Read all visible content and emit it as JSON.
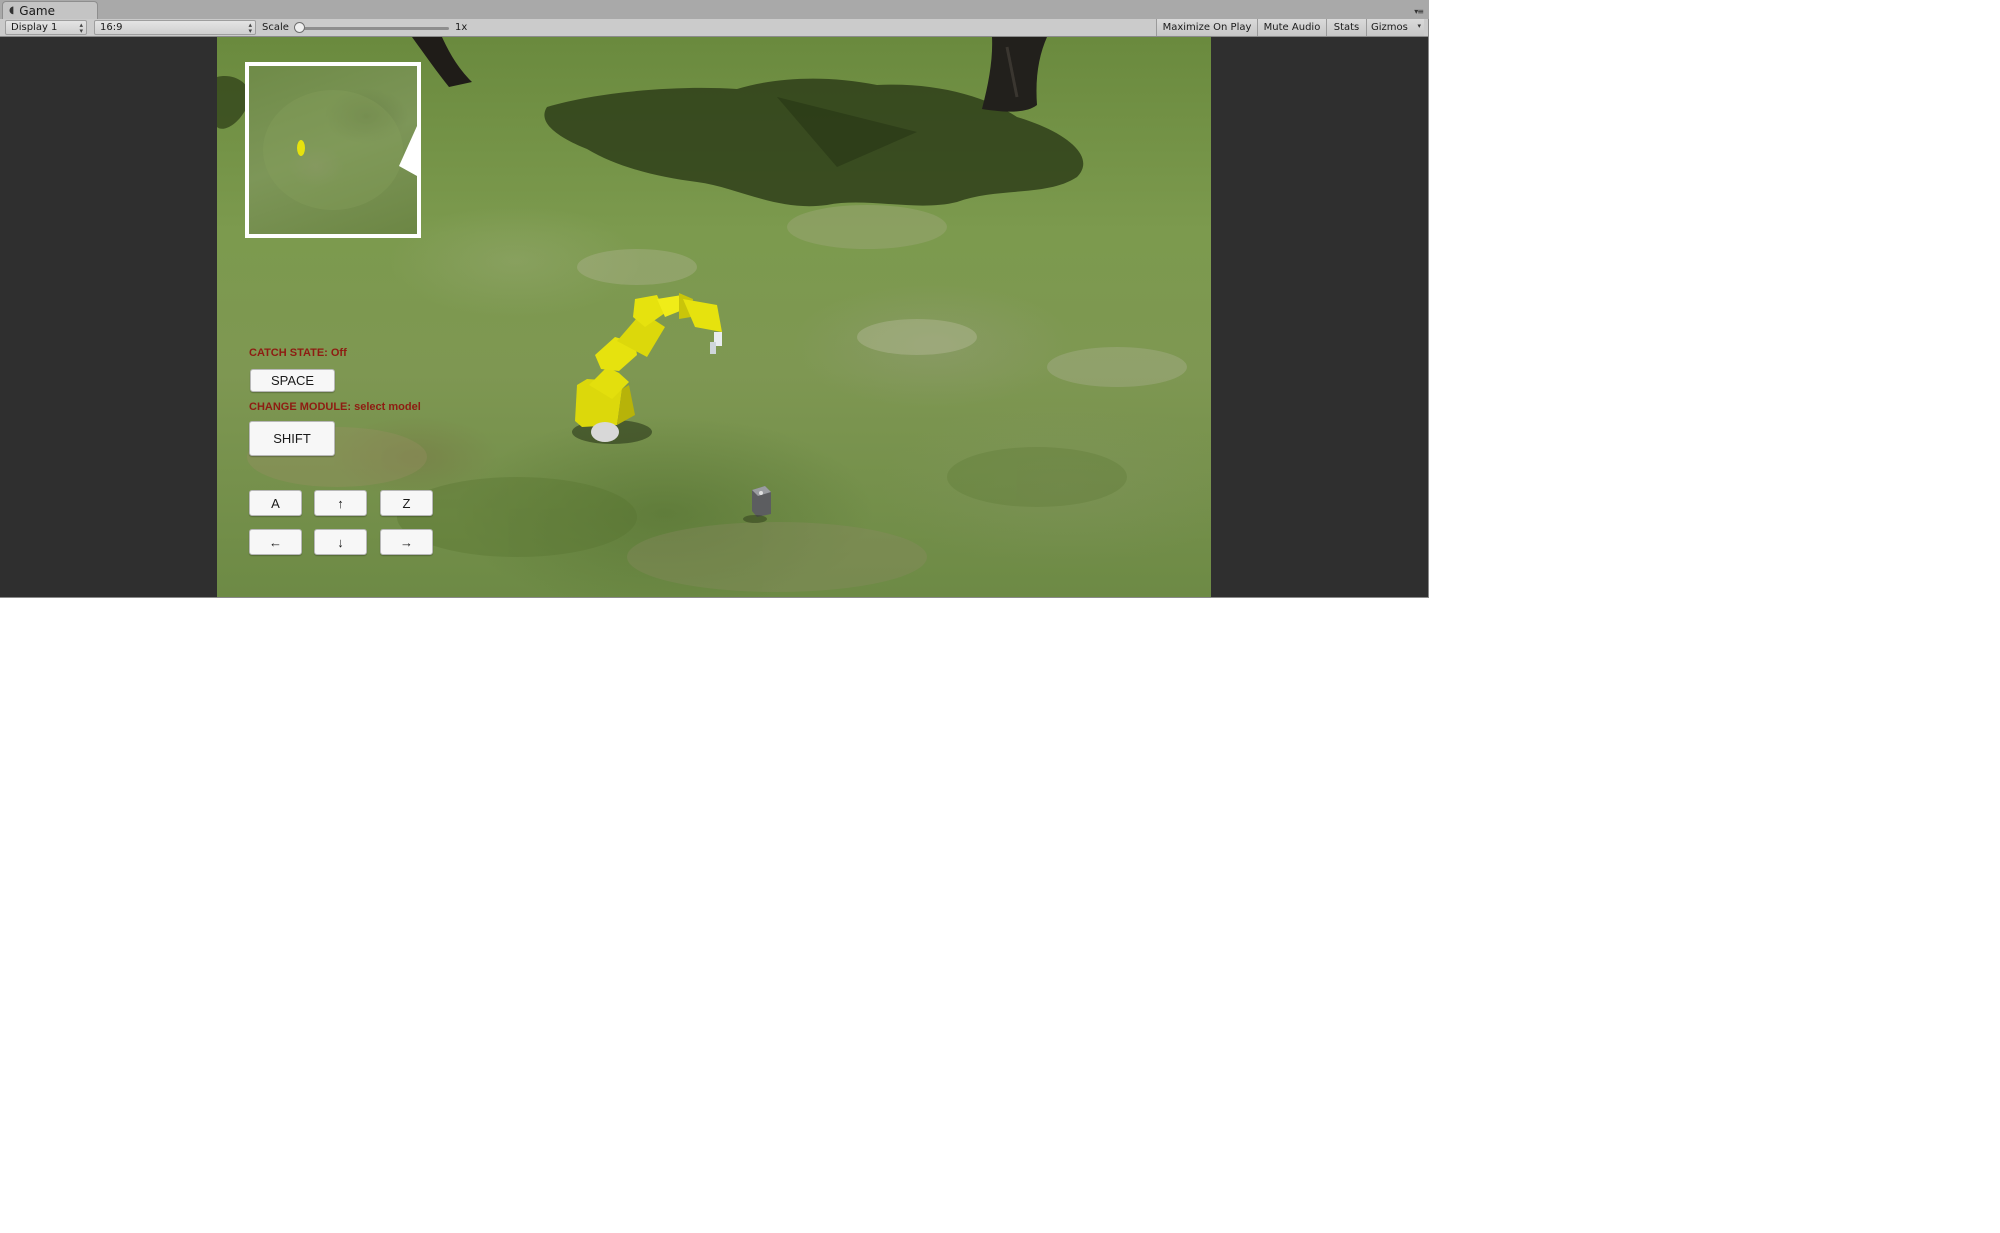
{
  "tab": {
    "title": "Game",
    "icon": "pacman-game-icon"
  },
  "toolbar": {
    "display": "Display 1",
    "aspect": "16:9",
    "scale_label": "Scale",
    "scale_value": "1x",
    "scale_level": 0.0,
    "maximize_on_play": "Maximize On Play",
    "mute_audio": "Mute Audio",
    "stats": "Stats",
    "gizmos": "Gizmos"
  },
  "hud": {
    "catch_state": "CATCH STATE: Off",
    "space_button": "SPACE",
    "change_module": "CHANGE MODULE: select model",
    "shift_button": "SHIFT",
    "keys": {
      "a": "A",
      "up": "↑",
      "z": "Z",
      "left": "←",
      "down": "↓",
      "right": "→"
    }
  },
  "colors": {
    "hud_label": "#8e1c12",
    "robot_yellow": "#e6e20e",
    "grass": "#7c9a4e"
  }
}
